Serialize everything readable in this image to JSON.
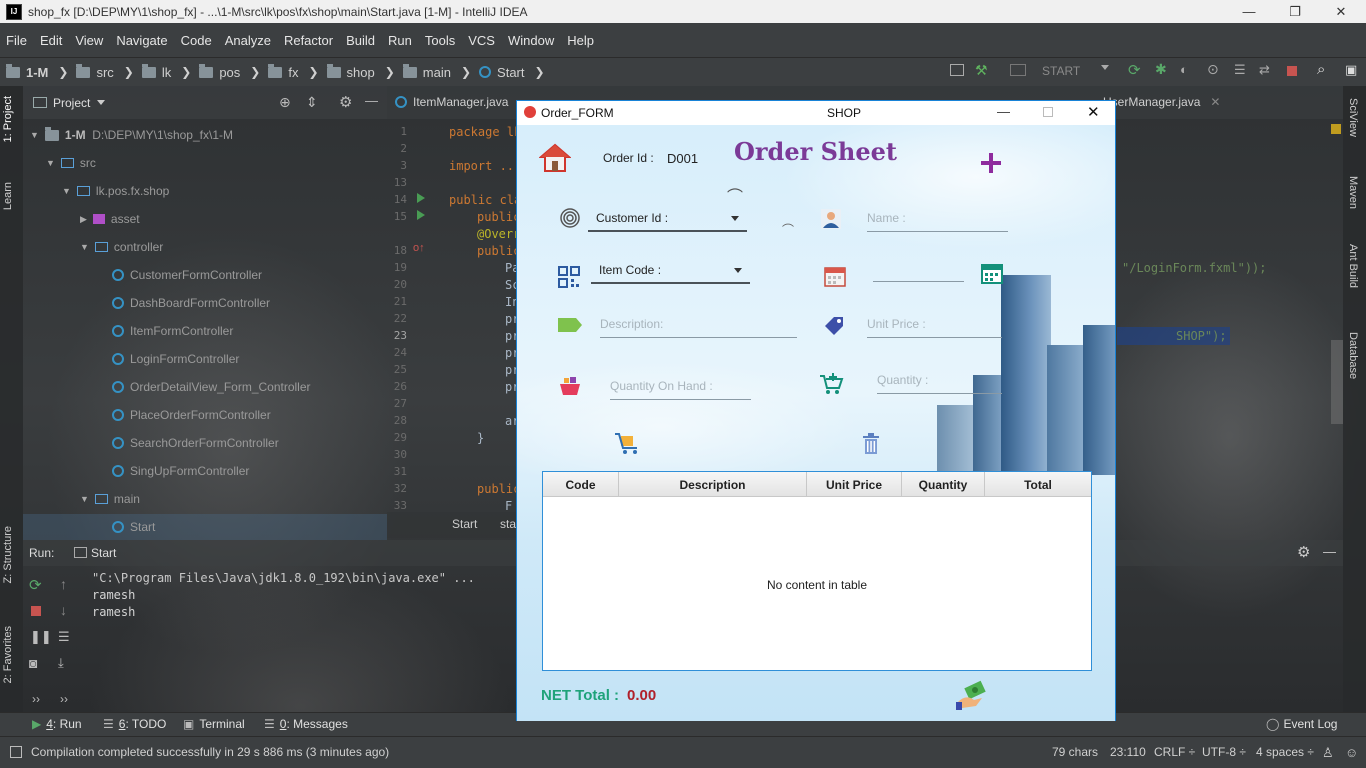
{
  "window": {
    "title": "shop_fx [D:\\DEP\\MY\\1\\shop_fx] - ...\\1-M\\src\\lk\\pos\\fx\\shop\\main\\Start.java [1-M] - IntelliJ IDEA",
    "logo": "IJ",
    "minimize_glyph": "—",
    "restore_glyph": "❐",
    "close_glyph": "✕"
  },
  "menu": [
    "File",
    "Edit",
    "View",
    "Navigate",
    "Code",
    "Analyze",
    "Refactor",
    "Build",
    "Run",
    "Tools",
    "VCS",
    "Window",
    "Help"
  ],
  "breadcrumbs": [
    "1-M",
    "src",
    "lk",
    "pos",
    "fx",
    "shop",
    "main",
    "Start"
  ],
  "run_config": "START",
  "project_panel": {
    "title": "Project",
    "root_name": "1-M",
    "root_path": "D:\\DEP\\MY\\1\\shop_fx\\1-M",
    "items": [
      "src",
      "lk.pos.fx.shop",
      "asset",
      "controller",
      "CustomerFormController",
      "DashBoardFormController",
      "ItemFormController",
      "LoginFormController",
      "OrderDetailView_Form_Controller",
      "PlaceOrderFormController",
      "SearchOrderFormController",
      "SingUpFormController",
      "main",
      "Start"
    ]
  },
  "editor": {
    "tabs": [
      "ItemManager.java",
      "UserManager.java"
    ],
    "line_numbers": [
      "1",
      "2",
      "3",
      "13",
      "14",
      "15",
      "18",
      "19",
      "20",
      "21",
      "22",
      "23",
      "24",
      "25",
      "26",
      "27",
      "28",
      "29",
      "30",
      "31",
      "32",
      "33"
    ],
    "code_lines": [
      "package lk",
      "import ...",
      "public cla",
      "public",
      "@Overr",
      "public",
      "Pa",
      "Sc",
      "In",
      "pr",
      "pr",
      "pr",
      "pr",
      "pr",
      "ar",
      "}",
      "public",
      "F"
    ],
    "code_fragment_right": "\"/LoginForm.fxml\"));",
    "code_fragment_shop": "SHOP\");",
    "breadcrumb_bottom": [
      "Start",
      "sta"
    ]
  },
  "run_panel": {
    "label": "Run:",
    "tab": "Start",
    "lines": [
      "\"C:\\Program Files\\Java\\jdk1.8.0_192\\bin\\java.exe\" ...",
      "ramesh",
      "ramesh"
    ]
  },
  "left_strip": [
    "1: Project",
    "Learn",
    "Z: Structure",
    "2: Favorites"
  ],
  "right_strip": [
    "SciView",
    "Maven",
    "Ant Build",
    "Database"
  ],
  "bottom_tools": [
    {
      "key": "4",
      "label": ": Run"
    },
    {
      "key": "6",
      "label": ": TODO"
    },
    {
      "key": "",
      "label": "Terminal"
    },
    {
      "key": "0",
      "label": ": Messages"
    }
  ],
  "event_log": "Event Log",
  "status": {
    "message": "Compilation completed successfully in 29 s 886 ms (3 minutes ago)",
    "chars": "79 chars",
    "position": "23:110",
    "line_sep": "CRLF ÷",
    "encoding": "UTF-8 ÷",
    "indent": "4 spaces ÷"
  },
  "order_form": {
    "window_title": "Order_FORM",
    "window_center_title": "SHOP",
    "heading": "Order Sheet",
    "order_id_label": "Order Id :",
    "order_id_value": "D001",
    "customer_id_label": "Customer Id :",
    "name_placeholder": "Name :",
    "item_code_label": "Item Code :",
    "description_placeholder": "Description:",
    "unit_price_placeholder": "Unit Price :",
    "qoh_placeholder": "Quantity On Hand :",
    "quantity_placeholder": "Quantity :",
    "table": {
      "columns": [
        "Code",
        "Description",
        "Unit Price",
        "Quantity",
        "Total"
      ],
      "empty_text": "No content in table"
    },
    "net_total_label": "NET Total :",
    "net_total_value": "0.00",
    "colors": {
      "heading": "#7b3a97",
      "net_total_label": "#1fa37a",
      "net_total_value": "#b0202a",
      "plus": "#8e2b9e"
    }
  }
}
